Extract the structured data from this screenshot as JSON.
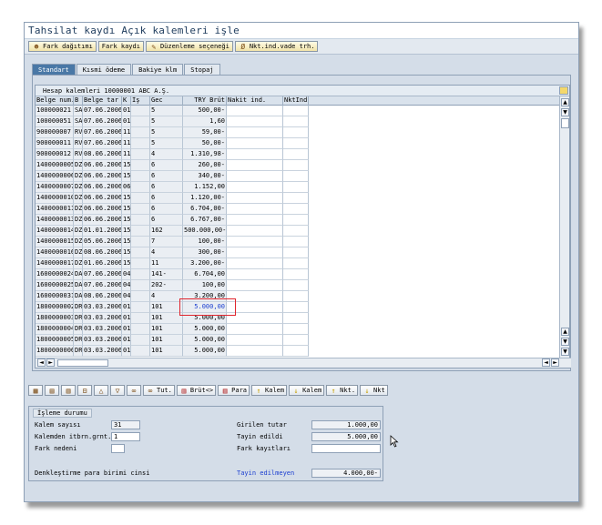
{
  "window": {
    "title": "Tahsilat kaydı Açık kalemleri işle"
  },
  "toolbar": [
    {
      "label": "Fark dağıtımı",
      "icon": "person-icon"
    },
    {
      "label": "Fark kaydı",
      "icon": ""
    },
    {
      "label": "Düzenleme seçeneği",
      "icon": "pencil-icon"
    },
    {
      "label": "Nkt.ind.vade trh.",
      "icon": "slash-icon"
    }
  ],
  "tabs": [
    "Standart",
    "Kısmi ödeme",
    "Bakiye klm",
    "Stopaj"
  ],
  "table": {
    "title": "Hesap kalemleri 10000001 ABC A.Ş.",
    "columns": [
      "Belge num.",
      "B",
      "Belge tar",
      "K",
      "İş",
      "Gec",
      "TRY Brüt",
      "Nakit ind.",
      "NktInd"
    ],
    "rows": [
      [
        "100000021",
        "SA",
        "07.06.2006",
        "01",
        "",
        "5",
        "500,00-",
        "",
        ""
      ],
      [
        "100000051",
        "SA",
        "07.06.2006",
        "01",
        "",
        "5",
        "1,60",
        "",
        ""
      ],
      [
        "900000007",
        "RV",
        "07.06.2006",
        "11",
        "",
        "5",
        "59,00-",
        "",
        ""
      ],
      [
        "900000011",
        "RV",
        "07.06.2006",
        "11",
        "",
        "5",
        "50,00-",
        "",
        ""
      ],
      [
        "900000012",
        "RV",
        "08.06.2006",
        "11",
        "",
        "4",
        "1.310,98-",
        "",
        ""
      ],
      [
        "1400000005",
        "DZ",
        "06.06.2006",
        "15",
        "",
        "6",
        "260,00-",
        "",
        ""
      ],
      [
        "1400000006",
        "DZ",
        "06.06.2006",
        "15",
        "",
        "6",
        "340,00-",
        "",
        ""
      ],
      [
        "1400000007",
        "DZ",
        "06.06.2006",
        "06",
        "",
        "6",
        "1.152,00",
        "",
        ""
      ],
      [
        "1400000010",
        "DZ",
        "06.06.2006",
        "15",
        "",
        "6",
        "1.120,00-",
        "",
        ""
      ],
      [
        "1400000011",
        "DZ",
        "06.06.2006",
        "15",
        "",
        "6",
        "6.704,00-",
        "",
        ""
      ],
      [
        "1400000013",
        "DZ",
        "06.06.2006",
        "15",
        "",
        "6",
        "6.767,00-",
        "",
        ""
      ],
      [
        "1400000014",
        "DZ",
        "01.01.2006",
        "15",
        "",
        "162",
        "500.000,00-",
        "",
        ""
      ],
      [
        "1400000015",
        "DZ",
        "05.06.2006",
        "15",
        "",
        "7",
        "100,00-",
        "",
        ""
      ],
      [
        "1400000016",
        "DZ",
        "08.06.2006",
        "15",
        "",
        "4",
        "300,00-",
        "",
        ""
      ],
      [
        "1400000017",
        "DZ",
        "01.06.2006",
        "15",
        "",
        "11",
        "3.200,00-",
        "",
        ""
      ],
      [
        "1600000024",
        "DA",
        "07.06.2006",
        "04",
        "",
        "141-",
        "6.704,00",
        "",
        ""
      ],
      [
        "1600000025",
        "DA",
        "07.06.2006",
        "04",
        "",
        "202-",
        "100,00",
        "",
        ""
      ],
      [
        "1600000031",
        "DA",
        "08.06.2006",
        "04",
        "",
        "4",
        "3.200,00",
        "",
        ""
      ],
      [
        "1800000002",
        "DR",
        "03.03.2006",
        "01",
        "",
        "101",
        "5.000,00",
        "",
        ""
      ],
      [
        "1800000003",
        "DR",
        "03.03.2006",
        "01",
        "",
        "101",
        "5.000,00",
        "",
        ""
      ],
      [
        "1800000004",
        "DR",
        "03.03.2006",
        "01",
        "",
        "101",
        "5.000,00",
        "",
        ""
      ],
      [
        "1800000005",
        "DR",
        "03.03.2006",
        "01",
        "",
        "101",
        "5.000,00",
        "",
        ""
      ],
      [
        "1800000006",
        "DR",
        "03.03.2006",
        "01",
        "",
        "101",
        "5.000,00",
        "",
        ""
      ]
    ]
  },
  "bottom_toolbar": {
    "tut_label": "Tut.",
    "brut_label": "Brüt<>",
    "para_label": "Para",
    "kalem_on_label": "Kalem",
    "kalem_off_label": "Kalem",
    "nkt_on_label": "Nkt.",
    "nkt_off_label": "Nkt"
  },
  "status": {
    "title": "İşleme durumu",
    "kalem_sayisi_label": "Kalem sayısı",
    "kalem_sayisi_value": "31",
    "itbrn_label": "Kalemden itbrn.grnt.",
    "itbrn_value": "1",
    "fark_nedeni_label": "Fark nedeni",
    "fark_nedeni_value": "",
    "denk_label": "Denkleştirme para birimi cinsi",
    "girilen_label": "Girilen tutar",
    "girilen_value": "1.000,00",
    "tayin_label": "Tayin edildi",
    "tayin_value": "5.000,00",
    "fark_label": "Fark kayıtları",
    "fark_value": "",
    "tayin_edilmeyen_label": "Tayin edilmeyen",
    "tayin_edilmeyen_value": "4.000,00-"
  }
}
